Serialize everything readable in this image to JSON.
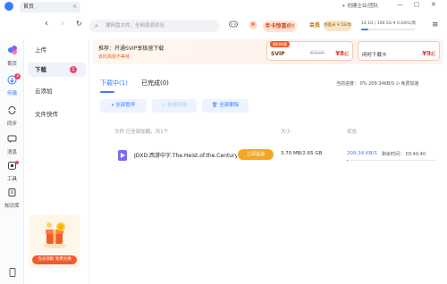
{
  "window": {
    "tab_title": "首页",
    "tab_close": "×",
    "create_enterprise": "+ 创建企业/团队",
    "min": "—",
    "restore": "▢",
    "close": "✕"
  },
  "toolbar": {
    "back": "‹",
    "forward": "›",
    "refresh": "↻",
    "search_placeholder": "搜网盘文件、全网资源资讯",
    "promo_label": "年卡惊喜价!",
    "member_label": "会员",
    "member_badge": "领鉴米 ¥ 18/周",
    "storage_text": "14.1G / 100.5G  ¥ 0.04/G/周",
    "storage_used_fraction": 0.14
  },
  "rail": {
    "items": [
      {
        "label": "首页",
        "icon": "home-icon"
      },
      {
        "label": "传输",
        "icon": "transfer-icon",
        "badge": "3",
        "active": true
      },
      {
        "label": "同步",
        "icon": "sync-icon"
      },
      {
        "label": "消息",
        "icon": "message-icon"
      },
      {
        "label": "工具",
        "icon": "tools-icon",
        "badge": ""
      },
      {
        "label": "知识库",
        "icon": "knowledge-icon"
      }
    ]
  },
  "subnav": {
    "upload": "上传",
    "download": "下载",
    "download_badge": "1",
    "cloud_add": "云添加",
    "file_transfer": "文件快传"
  },
  "ad": {
    "button": "会员领取 免费兑换"
  },
  "banner": {
    "line1": "推荐：开通SVIP享极速下载",
    "line2": "省时高效不等待",
    "card1_tag": "限时特惠",
    "card1_name": "SVIP",
    "card1_old": "¥25.00",
    "card1_price": "¥8",
    "card1_unit": "起",
    "card2_name": "闲时下载卡",
    "card2_price": "¥9",
    "card2_unit": "起"
  },
  "tabs": {
    "downloading": "下载中(1)",
    "completed": "已完成(0)"
  },
  "speed_info": "当前进度： 0%    209.34KB/S    ⊙ 免费加速",
  "actions": {
    "pause_all": "全部暂停",
    "start_all": "全部开始",
    "delete_all": "全部删除"
  },
  "table": {
    "header_file": "文件  已全部加载，共1个",
    "header_size": "大小",
    "header_status": "状态"
  },
  "rows": [
    {
      "name": "JDXD.西游中字.The.Heist.of.the.Century.mp4",
      "speedup": "立即提速",
      "size": "3.70 MB/2.65 GB",
      "speed": "209.34 KB/S",
      "remain": "剩余时间： 03:40:40",
      "progress": 0.01
    }
  ],
  "colors": {
    "accent": "#3b7cff",
    "badge": "#e84a6b",
    "promo": "#f35a2b",
    "speedup": "#f5a623"
  }
}
